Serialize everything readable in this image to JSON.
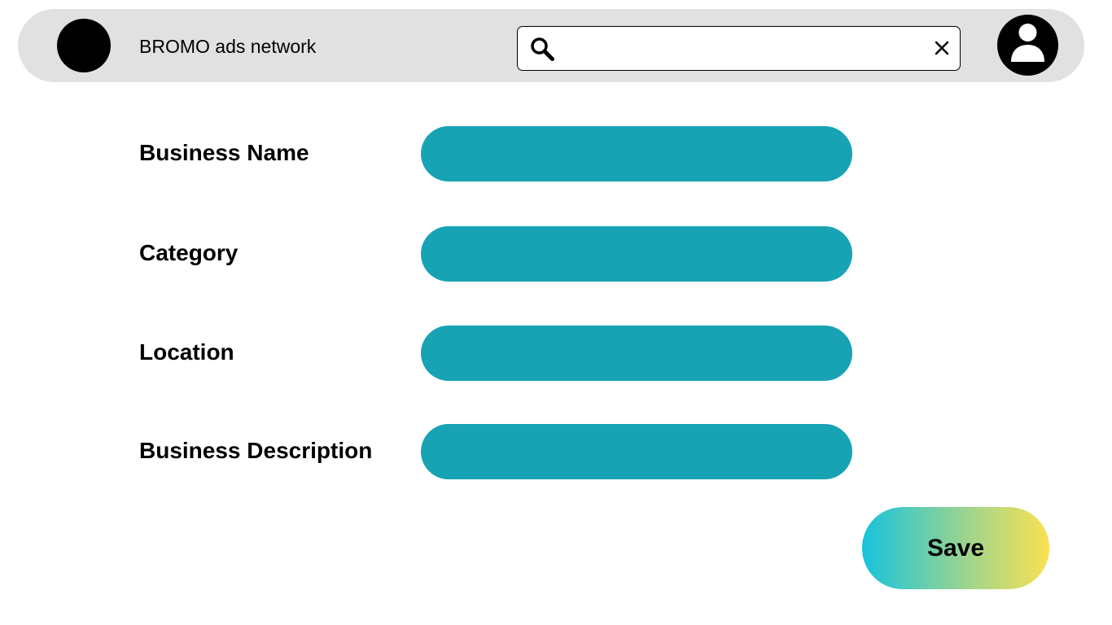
{
  "header": {
    "app_title": "BROMO ads network",
    "search": {
      "value": "",
      "placeholder": ""
    },
    "icons": [
      "logo-circle",
      "search-icon",
      "close-icon",
      "user-avatar-icon"
    ]
  },
  "form": {
    "fields": [
      {
        "label": "Business Name",
        "value": ""
      },
      {
        "label": "Category",
        "value": ""
      },
      {
        "label": "Location",
        "value": ""
      },
      {
        "label": "Business Description",
        "value": ""
      }
    ],
    "save_label": "Save"
  },
  "colors": {
    "header_bg": "#e1e1e1",
    "field_bg": "#17a3b4",
    "save_gradient_start": "#17c3dc",
    "save_gradient_end": "#fbe052"
  }
}
